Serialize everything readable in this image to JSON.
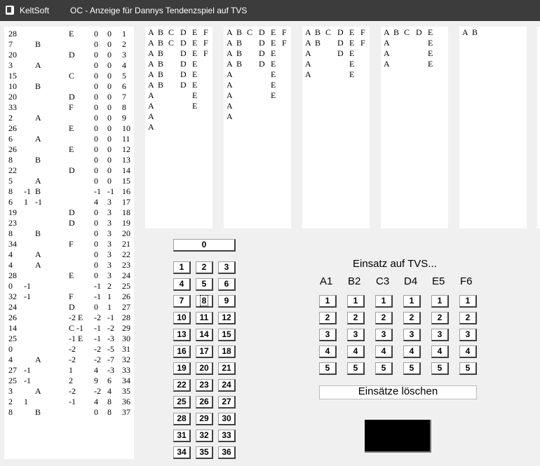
{
  "window": {
    "app_name": "KeltSoft",
    "title": "OC - Anzeige für Dannys Tendenzspiel auf TVS"
  },
  "history": [
    {
      "n": "28",
      "m": "",
      "l": "",
      "c": "E",
      "x": "0",
      "y": "0",
      "i": "1"
    },
    {
      "n": "7",
      "m": "",
      "l": "B",
      "c": "",
      "x": "0",
      "y": "0",
      "i": "2"
    },
    {
      "n": "20",
      "m": "",
      "l": "",
      "c": "D",
      "x": "0",
      "y": "0",
      "i": "3"
    },
    {
      "n": "3",
      "m": "",
      "l": "A",
      "c": "",
      "x": "0",
      "y": "0",
      "i": "4"
    },
    {
      "n": "15",
      "m": "",
      "l": "",
      "c": "C",
      "x": "0",
      "y": "0",
      "i": "5"
    },
    {
      "n": "10",
      "m": "",
      "l": "B",
      "c": "",
      "x": "0",
      "y": "0",
      "i": "6"
    },
    {
      "n": "20",
      "m": "",
      "l": "",
      "c": "D",
      "x": "0",
      "y": "0",
      "i": "7"
    },
    {
      "n": "33",
      "m": "",
      "l": "",
      "c": "F",
      "x": "0",
      "y": "0",
      "i": "8"
    },
    {
      "n": "2",
      "m": "",
      "l": "A",
      "c": "",
      "x": "0",
      "y": "0",
      "i": "9"
    },
    {
      "n": "26",
      "m": "",
      "l": "",
      "c": "E",
      "x": "0",
      "y": "0",
      "i": "10"
    },
    {
      "n": "6",
      "m": "",
      "l": "A",
      "c": "",
      "x": "0",
      "y": "0",
      "i": "11"
    },
    {
      "n": "26",
      "m": "",
      "l": "",
      "c": "E",
      "x": "0",
      "y": "0",
      "i": "12"
    },
    {
      "n": "8",
      "m": "",
      "l": "B",
      "c": "",
      "x": "0",
      "y": "0",
      "i": "13"
    },
    {
      "n": "22",
      "m": "",
      "l": "",
      "c": "D",
      "x": "0",
      "y": "0",
      "i": "14"
    },
    {
      "n": "5",
      "m": "",
      "l": "A",
      "c": "",
      "x": "0",
      "y": "0",
      "i": "15"
    },
    {
      "n": "8",
      "m": "-1",
      "l": "B",
      "c": "",
      "x": "-1",
      "y": "-1",
      "i": "16"
    },
    {
      "n": "6",
      "m": "1",
      "l": "-1",
      "c": "",
      "x": "4",
      "y": "3",
      "i": "17"
    },
    {
      "n": "19",
      "m": "",
      "l": "",
      "c": "D",
      "x": "0",
      "y": "3",
      "i": "18"
    },
    {
      "n": "23",
      "m": "",
      "l": "",
      "c": "D",
      "x": "0",
      "y": "3",
      "i": "19"
    },
    {
      "n": "8",
      "m": "",
      "l": "B",
      "c": "",
      "x": "0",
      "y": "3",
      "i": "20"
    },
    {
      "n": "34",
      "m": "",
      "l": "",
      "c": "F",
      "x": "0",
      "y": "3",
      "i": "21"
    },
    {
      "n": "4",
      "m": "",
      "l": "A",
      "c": "",
      "x": "0",
      "y": "3",
      "i": "22"
    },
    {
      "n": "4",
      "m": "",
      "l": "A",
      "c": "",
      "x": "0",
      "y": "3",
      "i": "23"
    },
    {
      "n": "28",
      "m": "",
      "l": "",
      "c": "E",
      "x": "0",
      "y": "3",
      "i": "24"
    },
    {
      "n": "0",
      "m": "-1",
      "l": "",
      "c": "",
      "x": "-1",
      "y": "2",
      "i": "25"
    },
    {
      "n": "32",
      "m": "-1",
      "l": "",
      "c": "F",
      "x": "-1",
      "y": "1",
      "i": "26"
    },
    {
      "n": "24",
      "m": "",
      "l": "",
      "c": "D",
      "x": "0",
      "y": "1",
      "i": "27"
    },
    {
      "n": "26",
      "m": "",
      "l": "",
      "c": "-2 E",
      "x": "-2",
      "y": "-1",
      "i": "28"
    },
    {
      "n": "14",
      "m": "",
      "l": "",
      "c": "C -1",
      "x": "-1",
      "y": "-2",
      "i": "29"
    },
    {
      "n": "25",
      "m": "",
      "l": "",
      "c": "-1 E",
      "x": "-1",
      "y": "-3",
      "i": "30"
    },
    {
      "n": "0",
      "m": "",
      "l": "",
      "c": "-2",
      "x": "-2",
      "y": "-5",
      "i": "31"
    },
    {
      "n": "4",
      "m": "",
      "l": "A",
      "c": "-2",
      "x": "-2",
      "y": "-7",
      "i": "32"
    },
    {
      "n": "27",
      "m": "-1",
      "l": "",
      "c": "1",
      "x": "4",
      "y": "-3",
      "i": "33"
    },
    {
      "n": "25",
      "m": "-1",
      "l": "",
      "c": "2",
      "x": "9",
      "y": "6",
      "i": "34"
    },
    {
      "n": "3",
      "m": "",
      "l": "A",
      "c": "-2",
      "x": "-2",
      "y": "4",
      "i": "35"
    },
    {
      "n": "2",
      "m": "1",
      "l": "",
      "c": "-1",
      "x": "4",
      "y": "8",
      "i": "36"
    },
    {
      "n": "8",
      "m": "",
      "l": "B",
      "c": "",
      "x": "0",
      "y": "8",
      "i": "37"
    }
  ],
  "panels": [
    {
      "rows": [
        [
          "A",
          "B",
          "C",
          "D",
          "E",
          "F"
        ],
        [
          "A",
          "B",
          "C",
          "D",
          "E",
          "F"
        ],
        [
          "A",
          "B",
          "",
          "D",
          "E",
          "F"
        ],
        [
          "A",
          "B",
          "",
          "D",
          "E",
          ""
        ],
        [
          "A",
          "B",
          "",
          "D",
          "E",
          ""
        ],
        [
          "A",
          "B",
          "",
          "D",
          "E",
          ""
        ],
        [
          "A",
          "",
          "",
          "",
          "E",
          ""
        ],
        [
          "A",
          "",
          "",
          "",
          "E",
          ""
        ],
        [
          "A",
          "",
          "",
          "",
          "",
          ""
        ],
        [
          "A",
          "",
          "",
          "",
          "",
          ""
        ]
      ]
    },
    {
      "rows": [
        [
          "A",
          "B",
          "C",
          "D",
          "E",
          "F"
        ],
        [
          "A",
          "B",
          "",
          "D",
          "E",
          "F"
        ],
        [
          "A",
          "B",
          "",
          "D",
          "E",
          ""
        ],
        [
          "A",
          "B",
          "",
          "D",
          "E",
          ""
        ],
        [
          "A",
          "",
          "",
          "",
          "E",
          ""
        ],
        [
          "A",
          "",
          "",
          "",
          "E",
          ""
        ],
        [
          "A",
          "",
          "",
          "",
          "E",
          ""
        ],
        [
          "A",
          "",
          "",
          "",
          "",
          ""
        ],
        [
          "A",
          "",
          "",
          "",
          "",
          ""
        ]
      ]
    },
    {
      "rows": [
        [
          "A",
          "B",
          "C",
          "D",
          "E",
          "F"
        ],
        [
          "A",
          "B",
          "",
          "D",
          "E",
          "F"
        ],
        [
          "A",
          "",
          "",
          "D",
          "E",
          ""
        ],
        [
          "A",
          "",
          "",
          "",
          "E",
          ""
        ],
        [
          "A",
          "",
          "",
          "",
          "E",
          ""
        ]
      ]
    },
    {
      "rows": [
        [
          "A",
          "B",
          "C",
          "D",
          "E",
          ""
        ],
        [
          "A",
          "",
          "",
          "",
          "E",
          ""
        ],
        [
          "A",
          "",
          "",
          "",
          "E",
          ""
        ],
        [
          "A",
          "",
          "",
          "",
          "E",
          ""
        ]
      ]
    },
    {
      "rows": [
        [
          "A",
          "B",
          "",
          "",
          "",
          ""
        ]
      ]
    }
  ],
  "numpad": {
    "zero": "0",
    "numbers": [
      "1",
      "2",
      "3",
      "4",
      "5",
      "6",
      "7",
      "8",
      "9",
      "10",
      "11",
      "12",
      "13",
      "14",
      "15",
      "16",
      "17",
      "18",
      "19",
      "20",
      "21",
      "22",
      "23",
      "24",
      "25",
      "26",
      "27",
      "28",
      "29",
      "30",
      "31",
      "32",
      "33",
      "34",
      "35",
      "36"
    ],
    "selected": "8"
  },
  "bets": {
    "heading": "Einsatz auf TVS...",
    "columns": [
      "A1",
      "B2",
      "C3",
      "D4",
      "E5",
      "F6"
    ],
    "amounts": [
      "1",
      "2",
      "3",
      "4",
      "5"
    ],
    "clear_label": "Einsätze löschen"
  }
}
